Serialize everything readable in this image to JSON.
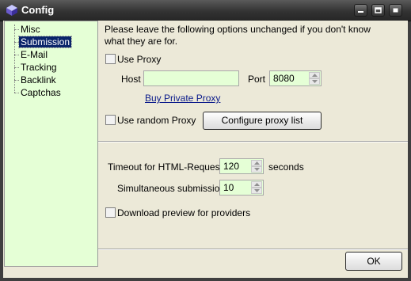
{
  "window": {
    "title": "Config"
  },
  "titlebar_buttons": [
    "minimize",
    "maximize",
    "close"
  ],
  "tree": {
    "items": [
      {
        "label": "Misc",
        "selected": false
      },
      {
        "label": "Submission",
        "selected": true
      },
      {
        "label": "E-Mail",
        "selected": false
      },
      {
        "label": "Tracking",
        "selected": false
      },
      {
        "label": "Backlink",
        "selected": false
      },
      {
        "label": "Captchas",
        "selected": false
      }
    ]
  },
  "proxy": {
    "info_text": "Please leave the following options unchanged if you don't know what they are for.",
    "use_proxy_label": "Use Proxy",
    "use_proxy_checked": false,
    "host_label": "Host",
    "host_value": "",
    "port_label": "Port",
    "port_value": "8080",
    "buy_link": "Buy Private Proxy",
    "use_random_label": "Use random Proxy",
    "use_random_checked": false,
    "configure_button": "Configure proxy list"
  },
  "requests": {
    "timeout_label": "Timeout for HTML-Requests",
    "timeout_value": "120",
    "timeout_unit": "seconds",
    "simultaneous_label": "Simultaneous submissions",
    "simultaneous_value": "10",
    "download_preview_label": "Download preview for providers",
    "download_preview_checked": false
  },
  "footer": {
    "ok_label": "OK"
  },
  "colors": {
    "field_bg": "#e5ffd6",
    "titlebar": "#333333",
    "dialog_bg": "#ece9d8",
    "selection": "#0a246a",
    "link": "#0a1a8a"
  }
}
